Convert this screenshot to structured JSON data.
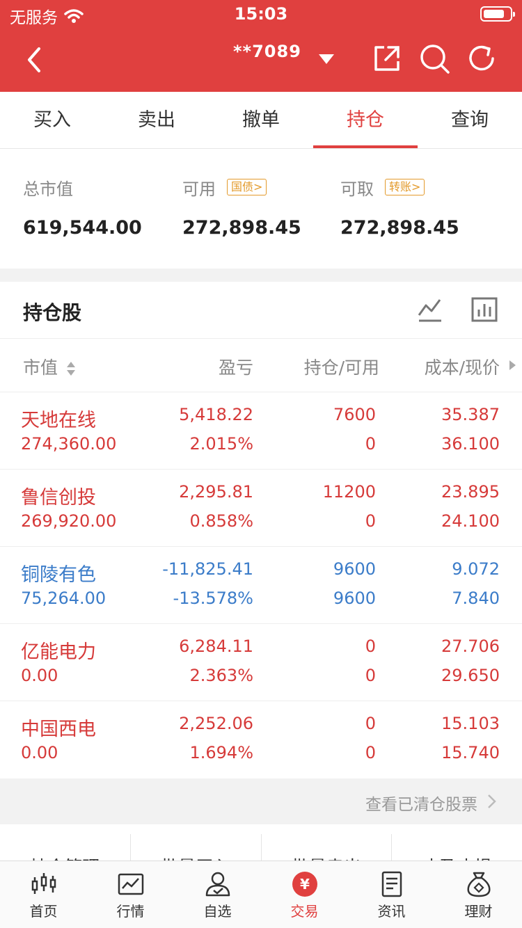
{
  "status_bar": {
    "carrier": "无服务",
    "time": "15:03",
    "battery_level": 0.8
  },
  "header": {
    "account": "**7089",
    "icons": [
      "back-icon",
      "account-dropdown-icon",
      "share-icon",
      "search-icon",
      "refresh-icon"
    ]
  },
  "tabs": [
    {
      "label": "买入",
      "active": false
    },
    {
      "label": "卖出",
      "active": false
    },
    {
      "label": "撤单",
      "active": false
    },
    {
      "label": "持仓",
      "active": true
    },
    {
      "label": "查询",
      "active": false
    }
  ],
  "summary": {
    "total_market_value_label": "总市值",
    "total_market_value": "619,544.00",
    "available_label": "可用",
    "available_tag": "国债",
    "available": "272,898.45",
    "withdrawable_label": "可取",
    "withdrawable_tag": "转账",
    "withdrawable": "272,898.45"
  },
  "holdings": {
    "title": "持仓股",
    "columns": {
      "market_value": "市值",
      "pl": "盈亏",
      "position": "持仓/可用",
      "price": "成本/现价"
    },
    "rows": [
      {
        "name": "天地在线",
        "market_value": "274,360.00",
        "pl": "5,418.22",
        "pl_pct": "2.015%",
        "qty": "7600",
        "avail": "0",
        "cost": "35.387",
        "price": "36.100",
        "trend": "up"
      },
      {
        "name": "鲁信创投",
        "market_value": "269,920.00",
        "pl": "2,295.81",
        "pl_pct": "0.858%",
        "qty": "11200",
        "avail": "0",
        "cost": "23.895",
        "price": "24.100",
        "trend": "up"
      },
      {
        "name": "铜陵有色",
        "market_value": "75,264.00",
        "pl": "-11,825.41",
        "pl_pct": "-13.578%",
        "qty": "9600",
        "avail": "9600",
        "cost": "9.072",
        "price": "7.840",
        "trend": "down"
      },
      {
        "name": "亿能电力",
        "market_value": "0.00",
        "pl": "6,284.11",
        "pl_pct": "2.363%",
        "qty": "0",
        "avail": "0",
        "cost": "27.706",
        "price": "29.650",
        "trend": "up"
      },
      {
        "name": "中国西电",
        "market_value": "0.00",
        "pl": "2,252.06",
        "pl_pct": "1.694%",
        "qty": "0",
        "avail": "0",
        "cost": "15.103",
        "price": "15.740",
        "trend": "up"
      }
    ],
    "cleared_link": "查看已清仓股票"
  },
  "quick_actions": [
    "持仓管理",
    "批量买入",
    "批量卖出",
    "止盈止损"
  ],
  "tabbar": [
    {
      "label": "首页",
      "icon": "candlestick-icon",
      "active": false
    },
    {
      "label": "行情",
      "icon": "market-chart-icon",
      "active": false
    },
    {
      "label": "自选",
      "icon": "user-check-icon",
      "active": false
    },
    {
      "label": "交易",
      "icon": "yuan-icon",
      "active": true
    },
    {
      "label": "资讯",
      "icon": "document-icon",
      "active": false
    },
    {
      "label": "理财",
      "icon": "money-bag-icon",
      "active": false
    }
  ],
  "colors": {
    "brand_red": "#e0403f",
    "gain": "#d63a39",
    "loss": "#3b7cc9",
    "tag_orange": "#e39a2b"
  }
}
